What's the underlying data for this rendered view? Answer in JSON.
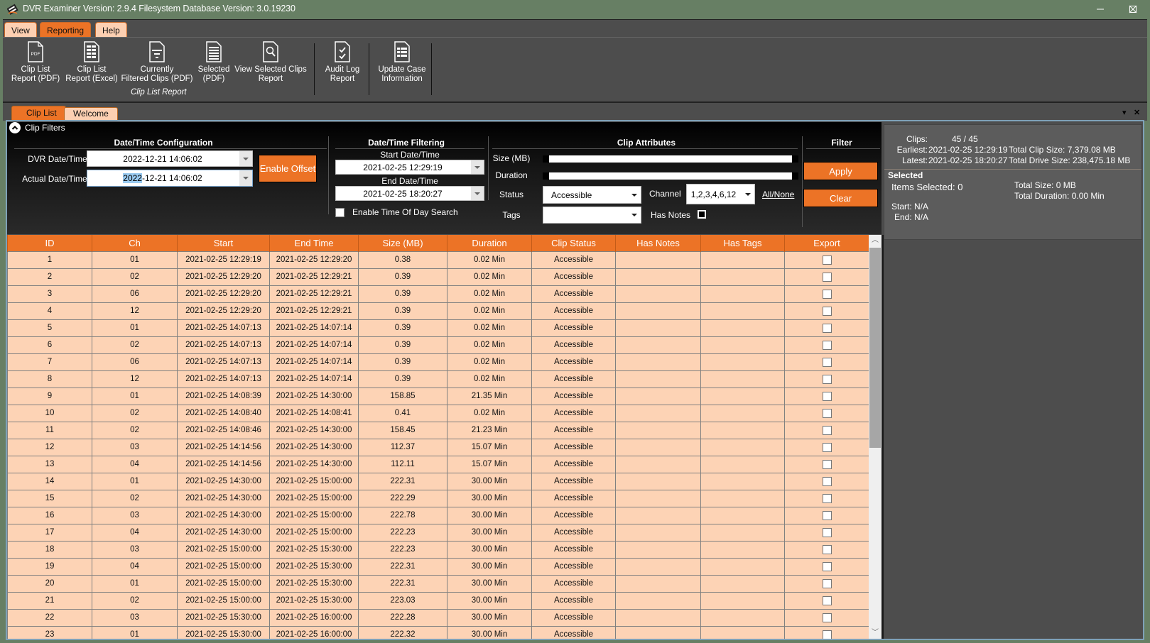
{
  "window": {
    "title": "DVR Examiner Version: 2.9.4 Filesystem Database Version: 3.0.19230",
    "controls": {
      "minimize": "—",
      "maximize": "☐",
      "close": "✕"
    }
  },
  "menu": {
    "tabs": [
      {
        "label": "View",
        "active": false
      },
      {
        "label": "Reporting",
        "active": true
      },
      {
        "label": "Help",
        "active": false
      }
    ]
  },
  "ribbon": {
    "buttons": [
      {
        "line1": "Clip List",
        "line2": "Report (PDF)",
        "icon": "pdf-document-icon"
      },
      {
        "line1": "Clip List",
        "line2": "Report (Excel)",
        "icon": "spreadsheet-document-icon"
      },
      {
        "line1": "Currently",
        "line2": "Filtered Clips (PDF)",
        "icon": "filter-document-icon"
      },
      {
        "line1": "Selected",
        "line2": "(PDF)",
        "icon": "list-document-icon"
      },
      {
        "line1": "View Selected Clips",
        "line2": "Report",
        "icon": "search-document-icon"
      },
      {
        "line1": "Audit Log",
        "line2": "Report",
        "icon": "checklist-document-icon"
      },
      {
        "line1": "Update Case",
        "line2": "Information",
        "icon": "info-document-icon"
      }
    ],
    "group_label": "Clip List Report"
  },
  "doc_tabs": [
    {
      "label": "Clip List",
      "active": true
    },
    {
      "label": "Welcome",
      "active": false
    }
  ],
  "filters": {
    "title": "Clip Filters",
    "datetime_config": {
      "heading": "Date/Time Configuration",
      "dvr_label": "DVR Date/Time:",
      "dvr_value": "2022-12-21 14:06:02",
      "actual_label": "Actual Date/Time:",
      "actual_value_selected": "2022",
      "actual_value_rest": "-12-21 14:06:02",
      "enable_offset": "Enable Offset"
    },
    "datetime_filter": {
      "heading": "Date/Time Filtering",
      "start_label": "Start Date/Time",
      "start_value": "2021-02-25 12:29:19",
      "end_label": "End Date/Time",
      "end_value": "2021-02-25 18:20:27",
      "time_of_day_label": "Enable Time Of Day Search",
      "time_of_day_checked": false
    },
    "clip_attributes": {
      "heading": "Clip Attributes",
      "size_label": "Size (MB)",
      "duration_label": "Duration",
      "size_range": {
        "min": 0,
        "max": 1
      },
      "duration_range": {
        "min": 0,
        "max": 1
      },
      "status_label": "Status",
      "status_value": "Accessible",
      "channel_label": "Channel",
      "channel_value": "1,2,3,4,6,12",
      "all_none": "All/None",
      "tags_label": "Tags",
      "tags_value": "",
      "has_notes_label": "Has Notes",
      "has_notes_checked": false
    },
    "filter": {
      "heading": "Filter",
      "apply": "Apply",
      "clear": "Clear"
    }
  },
  "info": {
    "clips_label": "Clips:",
    "clips_value": "45 / 45",
    "earliest_label": "Earliest:",
    "earliest_value": "2021-02-25 12:29:19",
    "latest_label": "Latest:",
    "latest_value": "2021-02-25 18:20:27",
    "total_clip_size": "Total Clip Size: 7,379.08 MB",
    "total_drive_size": "Total Drive Size: 238,475.18 MB",
    "selected_heading": "Selected",
    "items_selected": "Items Selected: 0",
    "total_size": "Total Size: 0 MB",
    "total_duration": "Total Duration: 0.00 Min",
    "start": "Start:  N/A",
    "end": "End:  N/A"
  },
  "table": {
    "columns": [
      "ID",
      "Ch",
      "Start",
      "End Time",
      "Size (MB)",
      "Duration",
      "Clip Status",
      "Has Notes",
      "Has Tags",
      "Export"
    ],
    "rows": [
      [
        "1",
        "01",
        "2021-02-25 12:29:19",
        "2021-02-25 12:29:20",
        "0.38",
        "0.02 Min",
        "Accessible",
        "",
        "",
        false
      ],
      [
        "2",
        "02",
        "2021-02-25 12:29:20",
        "2021-02-25 12:29:21",
        "0.39",
        "0.02 Min",
        "Accessible",
        "",
        "",
        false
      ],
      [
        "3",
        "06",
        "2021-02-25 12:29:20",
        "2021-02-25 12:29:21",
        "0.39",
        "0.02 Min",
        "Accessible",
        "",
        "",
        false
      ],
      [
        "4",
        "12",
        "2021-02-25 12:29:20",
        "2021-02-25 12:29:21",
        "0.39",
        "0.02 Min",
        "Accessible",
        "",
        "",
        false
      ],
      [
        "5",
        "01",
        "2021-02-25 14:07:13",
        "2021-02-25 14:07:14",
        "0.39",
        "0.02 Min",
        "Accessible",
        "",
        "",
        false
      ],
      [
        "6",
        "02",
        "2021-02-25 14:07:13",
        "2021-02-25 14:07:14",
        "0.39",
        "0.02 Min",
        "Accessible",
        "",
        "",
        false
      ],
      [
        "7",
        "06",
        "2021-02-25 14:07:13",
        "2021-02-25 14:07:14",
        "0.39",
        "0.02 Min",
        "Accessible",
        "",
        "",
        false
      ],
      [
        "8",
        "12",
        "2021-02-25 14:07:13",
        "2021-02-25 14:07:14",
        "0.39",
        "0.02 Min",
        "Accessible",
        "",
        "",
        false
      ],
      [
        "9",
        "01",
        "2021-02-25 14:08:39",
        "2021-02-25 14:30:00",
        "158.85",
        "21.35 Min",
        "Accessible",
        "",
        "",
        false
      ],
      [
        "10",
        "02",
        "2021-02-25 14:08:40",
        "2021-02-25 14:08:41",
        "0.41",
        "0.02 Min",
        "Accessible",
        "",
        "",
        false
      ],
      [
        "11",
        "02",
        "2021-02-25 14:08:46",
        "2021-02-25 14:30:00",
        "158.45",
        "21.23 Min",
        "Accessible",
        "",
        "",
        false
      ],
      [
        "12",
        "03",
        "2021-02-25 14:14:56",
        "2021-02-25 14:30:00",
        "112.37",
        "15.07 Min",
        "Accessible",
        "",
        "",
        false
      ],
      [
        "13",
        "04",
        "2021-02-25 14:14:56",
        "2021-02-25 14:30:00",
        "112.11",
        "15.07 Min",
        "Accessible",
        "",
        "",
        false
      ],
      [
        "14",
        "01",
        "2021-02-25 14:30:00",
        "2021-02-25 15:00:00",
        "222.31",
        "30.00 Min",
        "Accessible",
        "",
        "",
        false
      ],
      [
        "15",
        "02",
        "2021-02-25 14:30:00",
        "2021-02-25 15:00:00",
        "222.29",
        "30.00 Min",
        "Accessible",
        "",
        "",
        false
      ],
      [
        "16",
        "03",
        "2021-02-25 14:30:00",
        "2021-02-25 15:00:00",
        "222.78",
        "30.00 Min",
        "Accessible",
        "",
        "",
        false
      ],
      [
        "17",
        "04",
        "2021-02-25 14:30:00",
        "2021-02-25 15:00:00",
        "222.23",
        "30.00 Min",
        "Accessible",
        "",
        "",
        false
      ],
      [
        "18",
        "03",
        "2021-02-25 15:00:00",
        "2021-02-25 15:30:00",
        "222.23",
        "30.00 Min",
        "Accessible",
        "",
        "",
        false
      ],
      [
        "19",
        "04",
        "2021-02-25 15:00:00",
        "2021-02-25 15:30:00",
        "222.31",
        "30.00 Min",
        "Accessible",
        "",
        "",
        false
      ],
      [
        "20",
        "01",
        "2021-02-25 15:00:00",
        "2021-02-25 15:30:00",
        "222.31",
        "30.00 Min",
        "Accessible",
        "",
        "",
        false
      ],
      [
        "21",
        "02",
        "2021-02-25 15:00:00",
        "2021-02-25 15:30:00",
        "223.03",
        "30.00 Min",
        "Accessible",
        "",
        "",
        false
      ],
      [
        "22",
        "03",
        "2021-02-25 15:30:00",
        "2021-02-25 16:00:00",
        "222.28",
        "30.00 Min",
        "Accessible",
        "",
        "",
        false
      ],
      [
        "23",
        "01",
        "2021-02-25 15:30:00",
        "2021-02-25 16:00:00",
        "222.32",
        "30.00 Min",
        "Accessible",
        "",
        "",
        false
      ]
    ]
  },
  "colors": {
    "accent": "#ec7326",
    "row_background": "#fdd3b5",
    "titlebar": "#677f64",
    "panel": "#4d4d4d"
  }
}
